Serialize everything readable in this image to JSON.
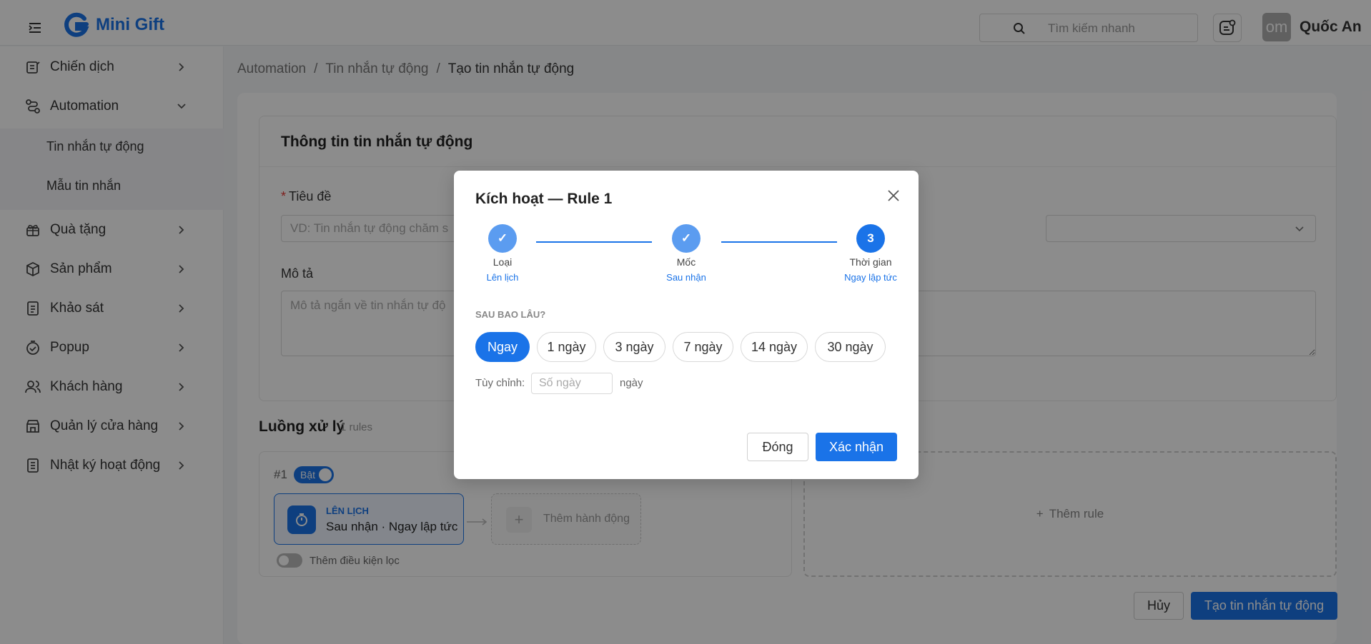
{
  "header": {
    "app_name": "Mini Gift",
    "search_placeholder": "Tìm kiếm nhanh",
    "avatar_text": "om",
    "user_name": "Quốc An"
  },
  "sidebar": {
    "items": [
      {
        "label": "Chiến dịch",
        "icon": "campaign-icon"
      },
      {
        "label": "Automation",
        "icon": "automation-icon",
        "expanded": true
      },
      {
        "label": "Quà tặng",
        "icon": "gift-icon"
      },
      {
        "label": "Sản phẩm",
        "icon": "box-icon"
      },
      {
        "label": "Khảo sát",
        "icon": "survey-icon"
      },
      {
        "label": "Popup",
        "icon": "popup-icon"
      },
      {
        "label": "Khách hàng",
        "icon": "users-icon"
      },
      {
        "label": "Quản lý cửa hàng",
        "icon": "store-icon"
      },
      {
        "label": "Nhật ký hoạt động",
        "icon": "log-icon"
      }
    ],
    "subitems": [
      "Tin nhắn tự động",
      "Mẫu tin nhắn"
    ]
  },
  "breadcrumb": [
    "Automation",
    "Tin nhắn tự động",
    "Tạo tin nhắn tự động"
  ],
  "form": {
    "card_title": "Thông tin tin nhắn tự động",
    "title_label": "Tiêu đề",
    "title_placeholder": "VD: Tin nhắn tự động chăm s",
    "description_label": "Mô tả",
    "description_placeholder": "Mô tả ngắn về tin nhắn tự độ"
  },
  "flow": {
    "title": "Luồng xử lý",
    "count": "1 rules",
    "rule": {
      "number": "#1",
      "enabled_label": "Bật",
      "enabled": true,
      "trigger_kind": "LÊN LỊCH",
      "trigger_desc": "Sau nhận · Ngay lập tức",
      "add_action": "Thêm hành động",
      "filter_label": "Thêm điều kiện lọc"
    },
    "add_rule": "Thêm rule"
  },
  "footer": {
    "cancel": "Hủy",
    "create": "Tạo tin nhắn tự động"
  },
  "modal": {
    "title": "Kích hoạt — Rule 1",
    "steps": [
      {
        "label": "Loại",
        "value": "Lên lịch",
        "state": "done",
        "mark": "✓"
      },
      {
        "label": "Mốc",
        "value": "Sau nhận",
        "state": "done",
        "mark": "✓"
      },
      {
        "label": "Thời gian",
        "value": "Ngay lập tức",
        "state": "active",
        "mark": "3"
      }
    ],
    "section_title": "SAU BAO LÂU?",
    "options": [
      "Ngay",
      "1 ngày",
      "3 ngày",
      "7 ngày",
      "14 ngày",
      "30 ngày"
    ],
    "selected_option": "Ngay",
    "custom_label": "Tùy chỉnh:",
    "custom_placeholder": "Số ngày",
    "custom_unit": "ngày",
    "close_label": "Đóng",
    "confirm_label": "Xác nhận"
  },
  "colors": {
    "primary": "#1a73e8",
    "overlay": "rgba(0,0,0,0.45)"
  }
}
